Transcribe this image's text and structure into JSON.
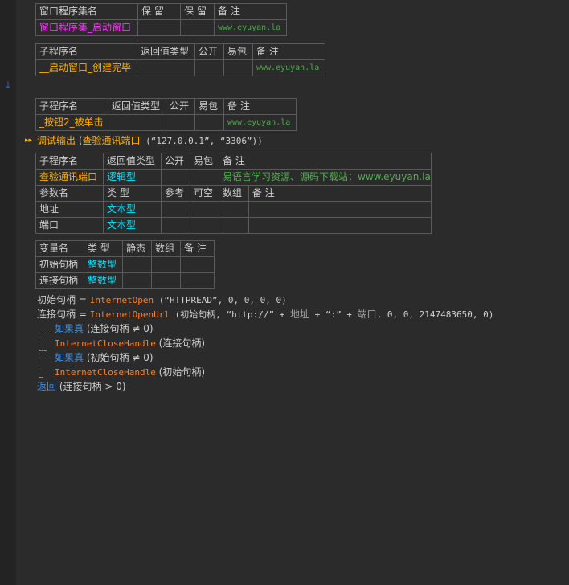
{
  "table1": {
    "headers": [
      "窗口程序集名",
      "保 留",
      "保 留",
      "备 注"
    ],
    "row": [
      "窗口程序集_启动窗口",
      "",
      "",
      "www.eyuyan.la"
    ]
  },
  "table2": {
    "headers": [
      "子程序名",
      "返回值类型",
      "公开",
      "易包",
      "备 注"
    ],
    "row": [
      "__启动窗口_创建完毕",
      "",
      "",
      "",
      "www.eyuyan.la"
    ]
  },
  "table3": {
    "headers": [
      "子程序名",
      "返回值类型",
      "公开",
      "易包",
      "备 注"
    ],
    "row": [
      "_按钮2_被单击",
      "",
      "",
      "",
      "www.eyuyan.la"
    ]
  },
  "debug_line": {
    "func": "调试输出",
    "paren_open": " (",
    "call": "查验通讯端口",
    "args": " (“127.0.0.1”, “3306”))"
  },
  "table4": {
    "headers": [
      "子程序名",
      "返回值类型",
      "公开",
      "易包",
      "备 注"
    ],
    "row": [
      "查验通讯端口",
      "逻辑型",
      "",
      "",
      "易语言学习资源、源码下载站：www.eyuyan.la"
    ],
    "param_headers": [
      "参数名",
      "类 型",
      "参考",
      "可空",
      "数组",
      "备 注"
    ],
    "params": [
      [
        "地址",
        "文本型",
        "",
        "",
        "",
        ""
      ],
      [
        "端口",
        "文本型",
        "",
        "",
        "",
        ""
      ]
    ]
  },
  "table5": {
    "headers": [
      "变量名",
      "类 型",
      "静态",
      "数组",
      "备 注"
    ],
    "rows": [
      [
        "初始句柄",
        "整数型",
        "",
        "",
        ""
      ],
      [
        "连接句柄",
        "整数型",
        "",
        "",
        ""
      ]
    ]
  },
  "code": {
    "l1_var": "初始句柄",
    "l1_eq": " = ",
    "l1_fn": "InternetOpen",
    "l1_args": " (“HTTPREAD”, 0, 0, 0, 0)",
    "l2_var": "连接句柄",
    "l2_eq": " = ",
    "l2_fn": "InternetOpenUrl",
    "l2_a": " (初始句柄, “http://” + ",
    "l2_b": "地址",
    "l2_c": " + “:” + ",
    "l2_d": "端口",
    "l2_e": ", 0, 0, 2147483650, 0)",
    "l3_kw": "如果真",
    "l3_rest": " (连接句柄 ≠ 0)",
    "l4_fn": "InternetCloseHandle",
    "l4_rest": " (连接句柄)",
    "l5_kw": "如果真",
    "l5_rest": " (初始句柄 ≠ 0)",
    "l6_fn": "InternetCloseHandle",
    "l6_rest": " (初始句柄)",
    "l7_kw": "返回",
    "l7_rest": " (连接句柄 > 0)"
  }
}
